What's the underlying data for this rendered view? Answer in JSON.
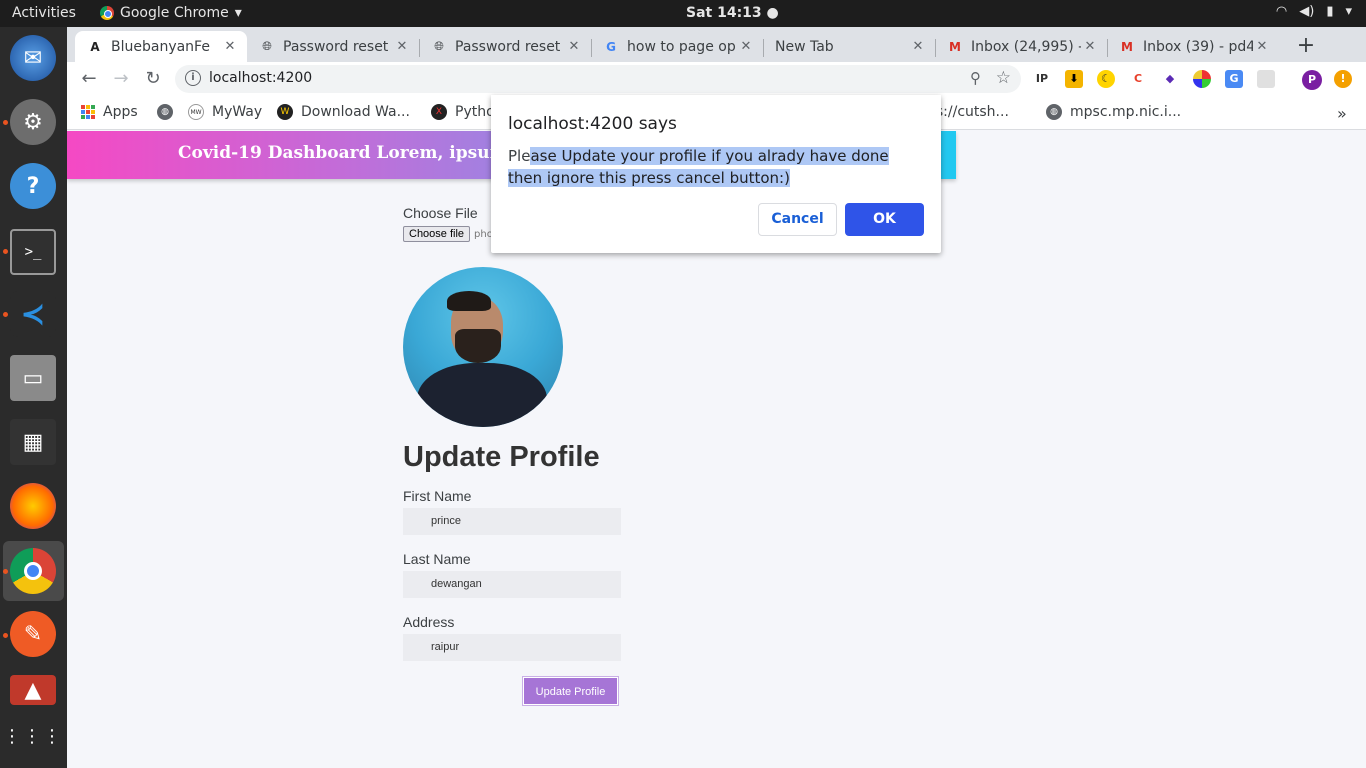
{
  "system": {
    "activities": "Activities",
    "app_name": "Google Chrome",
    "clock": "Sat 14:13 ●"
  },
  "tabs": [
    {
      "label": "BluebanyanFe",
      "icon": "angular-icon",
      "active": true
    },
    {
      "label": "Password reset",
      "icon": "globe-icon"
    },
    {
      "label": "Password reset",
      "icon": "globe-icon"
    },
    {
      "label": "how to page op",
      "icon": "google-icon"
    },
    {
      "label": "New Tab",
      "icon": "none"
    },
    {
      "label": "Inbox (24,995) -",
      "icon": "gmail-icon"
    },
    {
      "label": "Inbox (39) - pd4",
      "icon": "gmail-icon"
    }
  ],
  "toolbar": {
    "url": "localhost:4200"
  },
  "bookmarks": {
    "apps": "Apps",
    "myway": "MyWay",
    "download": "Download Wa...",
    "python": "Pytho",
    "cutsh": "ps://cutsh...",
    "mpsc": "mpsc.mp.nic.i..."
  },
  "banner": {
    "title": "Covid-19 Dashboard Lorem, ipsum do"
  },
  "profile_form": {
    "choose_file_label": "Choose File",
    "choose_file_button": "Choose file",
    "file_name": "pho",
    "title": "Update Profile",
    "first_name_label": "First Name",
    "first_name_value": "prince",
    "last_name_label": "Last Name",
    "last_name_value": "dewangan",
    "address_label": "Address",
    "address_value": "raipur",
    "submit_label": "Update Profile"
  },
  "dialog": {
    "title": "localhost:4200 says",
    "message_plain": "Ple",
    "message_selected": "ase Update your profile if you alrady have done then ignore this press cancel button:)",
    "cancel_label": "Cancel",
    "ok_label": "OK"
  },
  "colors": {
    "dialog_ok": "#2f54e8",
    "submit_button": "#a675d6",
    "selection": "#aec8f5"
  }
}
